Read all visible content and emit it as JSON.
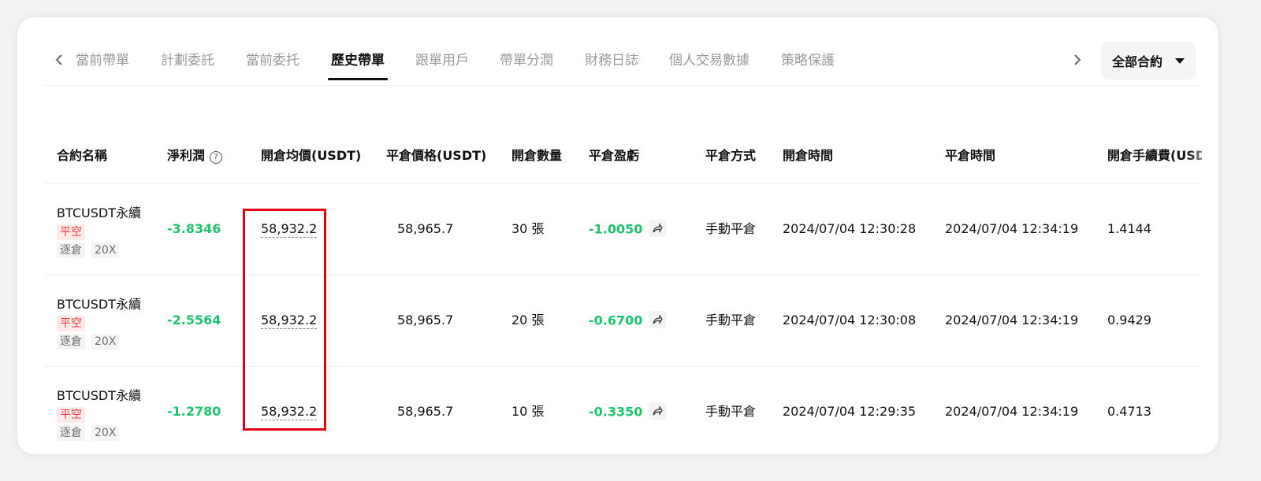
{
  "tabs": [
    {
      "label": "當前帶單"
    },
    {
      "label": "計劃委託"
    },
    {
      "label": "當前委托"
    },
    {
      "label": "歷史帶單"
    },
    {
      "label": "跟單用戶"
    },
    {
      "label": "帶單分潤"
    },
    {
      "label": "財務日誌"
    },
    {
      "label": "個人交易數據"
    },
    {
      "label": "策略保護"
    }
  ],
  "active_tab": "歷史帶單",
  "filter": {
    "label": "全部合約"
  },
  "columns": [
    "合約名稱",
    "淨利潤",
    "開倉均價(USDT)",
    "平倉價格(USDT)",
    "開倉數量",
    "平倉盈虧",
    "平倉方式",
    "開倉時間",
    "平倉時間",
    "開倉手續費(USDT)"
  ],
  "rows": [
    {
      "symbol": "BTCUSDT永續",
      "side": "平空",
      "mode": "逐倉",
      "leverage": "20X",
      "net_profit": "-3.8346",
      "open_price": "58,932.2",
      "close_price": "58,965.7",
      "qty": "30 張",
      "pnl": "-1.0050",
      "close_method": "手動平倉",
      "open_time": "2024/07/04 12:30:28",
      "close_time": "2024/07/04 12:34:19",
      "fee": "1.4144"
    },
    {
      "symbol": "BTCUSDT永續",
      "side": "平空",
      "mode": "逐倉",
      "leverage": "20X",
      "net_profit": "-2.5564",
      "open_price": "58,932.2",
      "close_price": "58,965.7",
      "qty": "20 張",
      "pnl": "-0.6700",
      "close_method": "手動平倉",
      "open_time": "2024/07/04 12:30:08",
      "close_time": "2024/07/04 12:34:19",
      "fee": "0.9429"
    },
    {
      "symbol": "BTCUSDT永續",
      "side": "平空",
      "mode": "逐倉",
      "leverage": "20X",
      "net_profit": "-1.2780",
      "open_price": "58,932.2",
      "close_price": "58,965.7",
      "qty": "10 張",
      "pnl": "-0.3350",
      "close_method": "手動平倉",
      "open_time": "2024/07/04 12:29:35",
      "close_time": "2024/07/04 12:34:19",
      "fee": "0.4713"
    }
  ],
  "colors": {
    "profit_green": "#1fc26e",
    "short_red": "#f53b3b",
    "highlight_red": "#e50012"
  }
}
